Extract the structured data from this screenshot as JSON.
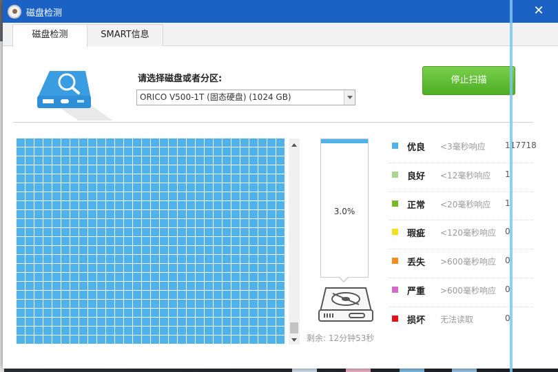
{
  "window": {
    "title": "磁盘检测",
    "close_glyph": "✕"
  },
  "tabs": [
    {
      "label": "磁盘检测",
      "active": true
    },
    {
      "label": "SMART信息",
      "active": false
    }
  ],
  "disk_select": {
    "label": "请选择磁盘或者分区:",
    "value": "ORICO V500-1T (固态硬盘)  (1024 GB)"
  },
  "stop_button": {
    "label": "停止扫描",
    "color": "#5bbf32"
  },
  "grid": {
    "cell_color": "#4fb3ea"
  },
  "progress": {
    "percent": 3.0,
    "label": "3.0%",
    "color": "#4fb3ea"
  },
  "remaining_label": "剩余: 12分钟53秒",
  "legend": [
    {
      "name": "优良",
      "desc": "<3毫秒响应",
      "count": "117718",
      "color": "#4fb3ea"
    },
    {
      "name": "良好",
      "desc": "<12毫秒响应",
      "count": "1",
      "color": "#a9d78e"
    },
    {
      "name": "正常",
      "desc": "<20毫秒响应",
      "count": "1",
      "color": "#7ab829"
    },
    {
      "name": "瑕疵",
      "desc": "<120毫秒响应",
      "count": "0",
      "color": "#f2e21e"
    },
    {
      "name": "丢失",
      "desc": ">600毫秒响应",
      "count": "0",
      "color": "#f38b1f"
    },
    {
      "name": "严重",
      "desc": ">600毫秒响应",
      "count": "0",
      "color": "#d36bcd"
    },
    {
      "name": "损坏",
      "desc": "无法读取",
      "count": "0",
      "color": "#e3131b"
    }
  ]
}
